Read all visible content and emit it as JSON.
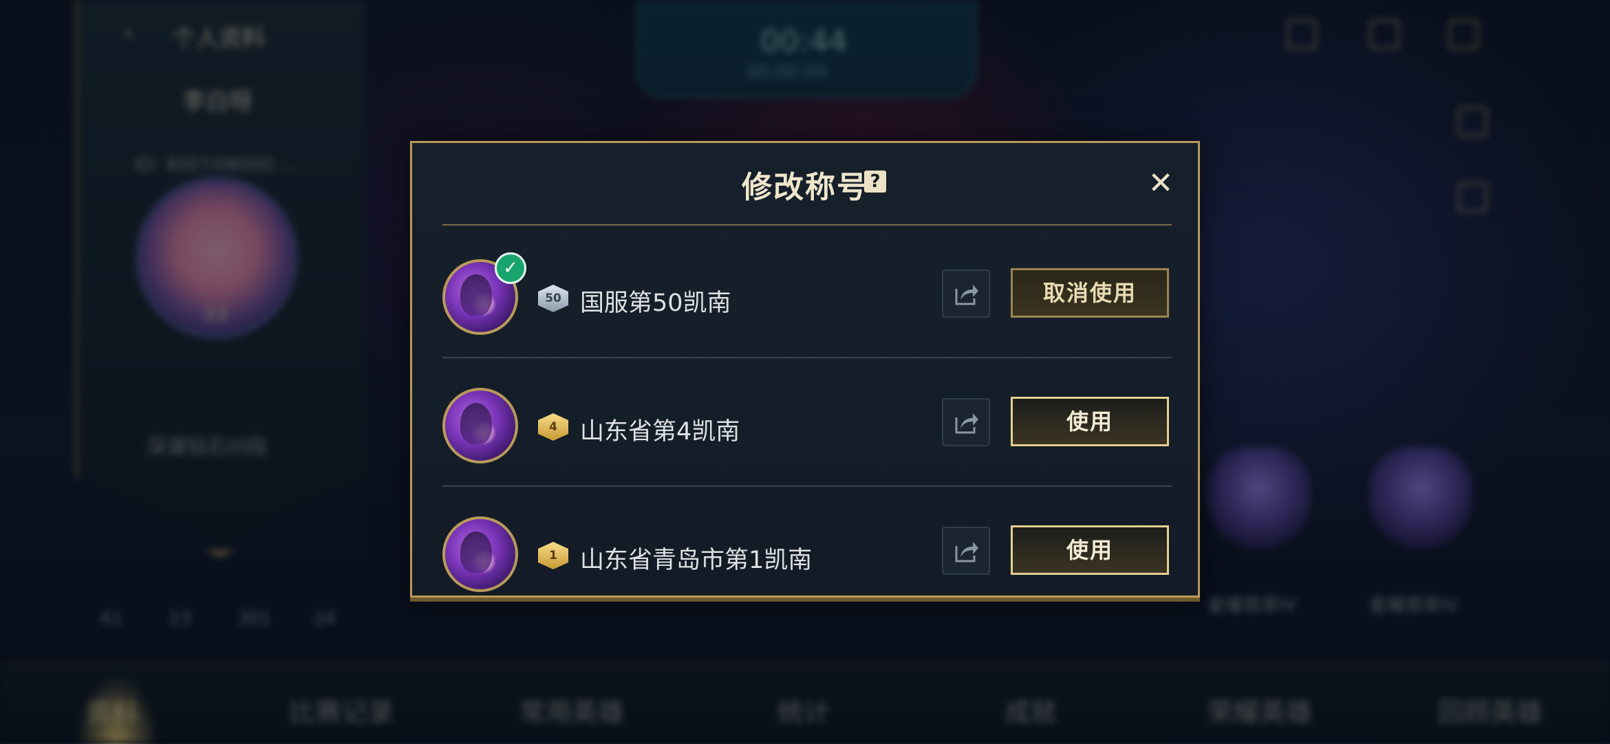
{
  "background": {
    "profile_tab": "个人资料",
    "player_name": "李白呀",
    "player_id_line": "ID: 4007/08000 ...",
    "player_level": "33",
    "player_rank": "深邃钻石III段",
    "timer": "00:44",
    "timer_sub": "00:00:00",
    "stats": [
      "41",
      "23",
      "301",
      "24"
    ],
    "emblem_labels": [
      "星耀翡翠IV",
      "星耀翡翠IV"
    ],
    "bottom_nav": [
      "资料",
      "比赛记录",
      "常用英雄",
      "统计",
      "成就",
      "荣耀英雄",
      "回顾英雄"
    ]
  },
  "dialog": {
    "title": "修改称号",
    "help_glyph": "?",
    "close_glyph": "✕",
    "share_icon": "share-arrow-icon",
    "rows": [
      {
        "badge_number": "50",
        "badge_tier": "silver",
        "title": "国服第50凯南",
        "action": "取消使用",
        "equipped": true
      },
      {
        "badge_number": "4",
        "badge_tier": "gold",
        "title": "山东省第4凯南",
        "action": "使用",
        "equipped": false
      },
      {
        "badge_number": "1",
        "badge_tier": "gold",
        "title": "山东省青岛市第1凯南",
        "action": "使用",
        "equipped": false
      }
    ]
  },
  "colors": {
    "gold_border": "#b99a5a",
    "dialog_bg": "#16202b",
    "equipped_check": "#1aa56e"
  }
}
